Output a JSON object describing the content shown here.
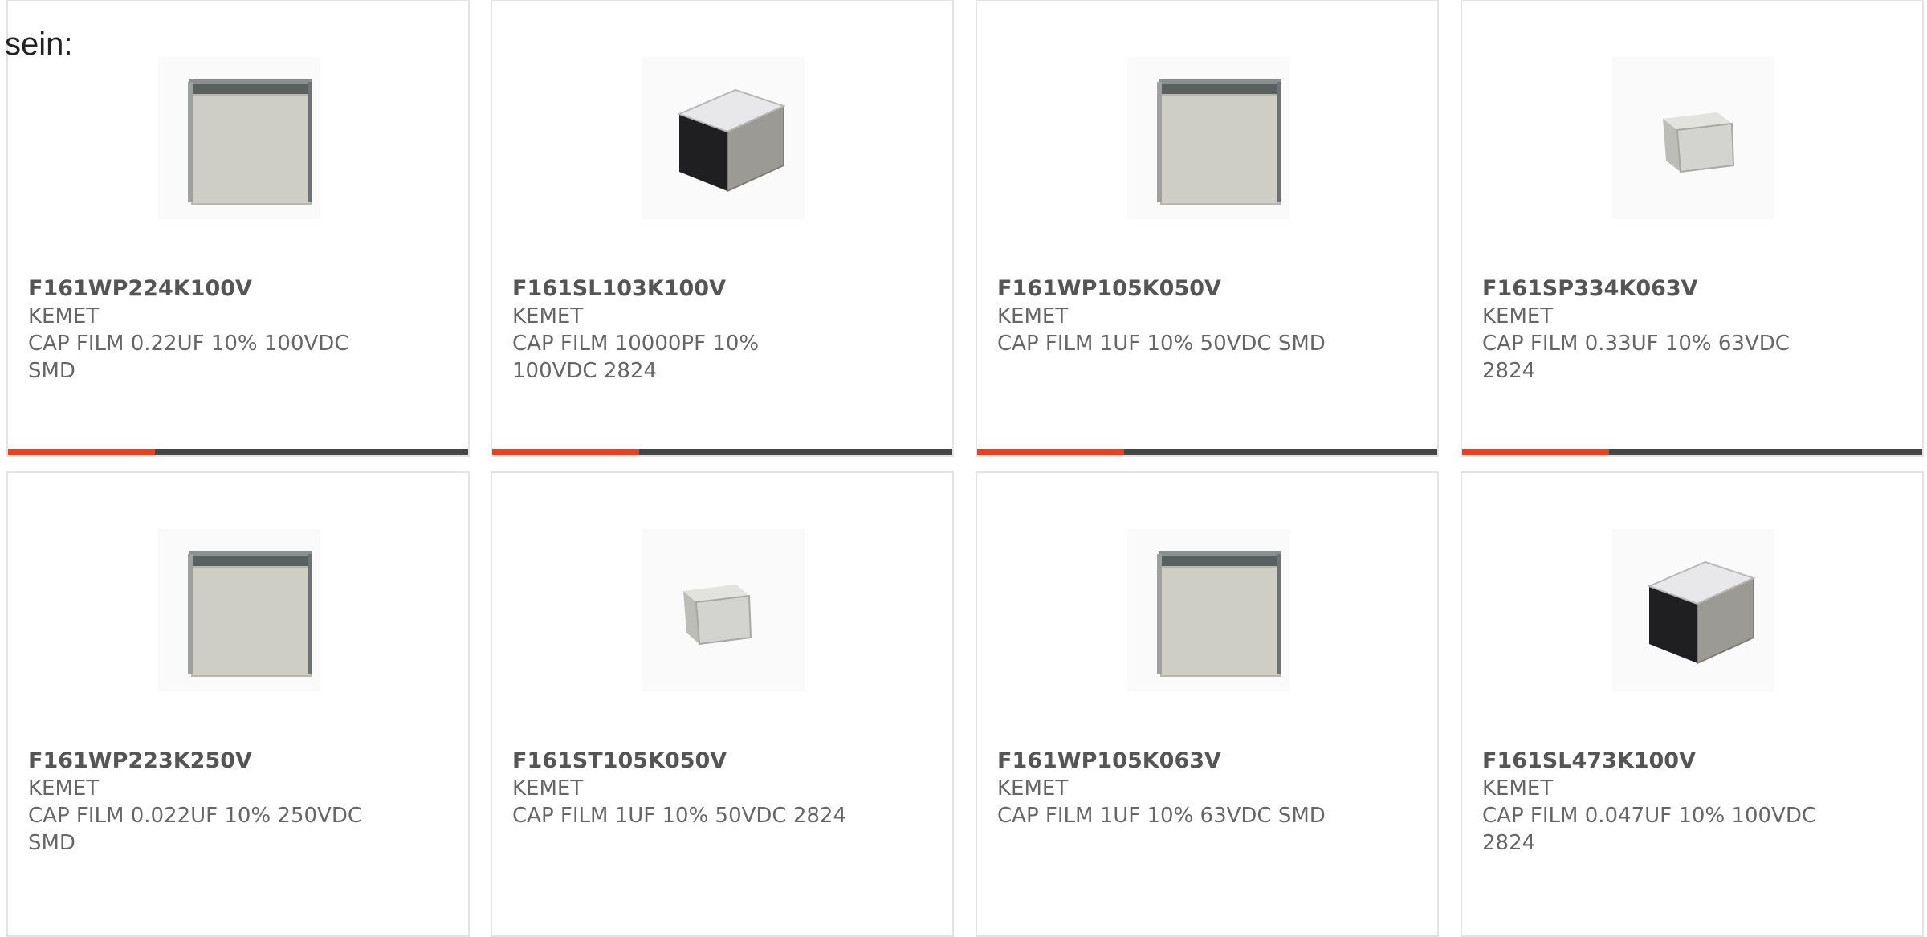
{
  "page": {
    "lead_text": "sein:"
  },
  "colors": {
    "card_border": "#e3e3e3",
    "progress_accent": "#e3431f",
    "progress_track": "#444444",
    "title_text": "#555555",
    "body_text": "#666666"
  },
  "products": [
    {
      "part_number": "F161WP224K100V",
      "manufacturer": "KEMET",
      "description": "CAP FILM 0.22UF 10% 100VDC SMD",
      "image": "wp-film-capacitor-image",
      "progress": 0.32
    },
    {
      "part_number": "F161SL103K100V",
      "manufacturer": "KEMET",
      "description": "CAP FILM 10000PF 10% 100VDC 2824",
      "image": "sl-film-capacitor-image",
      "progress": 0.32
    },
    {
      "part_number": "F161WP105K050V",
      "manufacturer": "KEMET",
      "description": "CAP FILM 1UF 10% 50VDC SMD",
      "image": "wp-film-capacitor-image",
      "progress": 0.32
    },
    {
      "part_number": "F161SP334K063V",
      "manufacturer": "KEMET",
      "description": "CAP FILM 0.33UF 10% 63VDC 2824",
      "image": "small-film-capacitor-image",
      "progress": 0.32
    },
    {
      "part_number": "F161WP223K250V",
      "manufacturer": "KEMET",
      "description": "CAP FILM 0.022UF 10% 250VDC SMD",
      "image": "wp-film-capacitor-image"
    },
    {
      "part_number": "F161ST105K050V",
      "manufacturer": "KEMET",
      "description": "CAP FILM 1UF 10% 50VDC 2824",
      "image": "small-film-capacitor-image"
    },
    {
      "part_number": "F161WP105K063V",
      "manufacturer": "KEMET",
      "description": "CAP FILM 1UF 10% 63VDC SMD",
      "image": "wp-film-capacitor-image"
    },
    {
      "part_number": "F161SL473K100V",
      "manufacturer": "KEMET",
      "description": "CAP FILM 0.047UF 10% 100VDC 2824",
      "image": "sl-film-capacitor-image"
    }
  ]
}
